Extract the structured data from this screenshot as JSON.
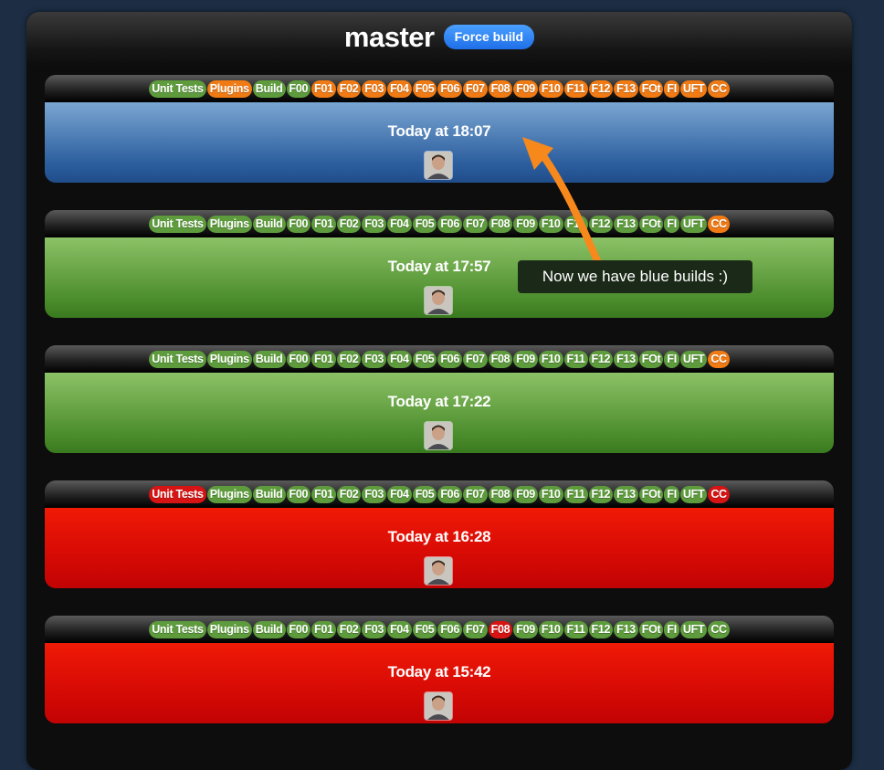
{
  "header": {
    "branch": "master",
    "force_build_label": "Force build"
  },
  "builds": [
    {
      "time": "Today at 18:07",
      "status": "blue",
      "stages": [
        {
          "label": "Unit Tests",
          "status": "green"
        },
        {
          "label": "Plugins",
          "status": "orange"
        },
        {
          "label": "Build",
          "status": "green"
        },
        {
          "label": "F00",
          "status": "green"
        },
        {
          "label": "F01",
          "status": "orange"
        },
        {
          "label": "F02",
          "status": "orange"
        },
        {
          "label": "F03",
          "status": "orange"
        },
        {
          "label": "F04",
          "status": "orange"
        },
        {
          "label": "F05",
          "status": "orange"
        },
        {
          "label": "F06",
          "status": "orange"
        },
        {
          "label": "F07",
          "status": "orange"
        },
        {
          "label": "F08",
          "status": "orange"
        },
        {
          "label": "F09",
          "status": "orange"
        },
        {
          "label": "F10",
          "status": "orange"
        },
        {
          "label": "F11",
          "status": "orange"
        },
        {
          "label": "F12",
          "status": "orange"
        },
        {
          "label": "F13",
          "status": "orange"
        },
        {
          "label": "FOt",
          "status": "orange"
        },
        {
          "label": "FI",
          "status": "orange"
        },
        {
          "label": "UFT",
          "status": "orange"
        },
        {
          "label": "CC",
          "status": "orange"
        }
      ]
    },
    {
      "time": "Today at 17:57",
      "status": "green",
      "stages": [
        {
          "label": "Unit Tests",
          "status": "green"
        },
        {
          "label": "Plugins",
          "status": "green"
        },
        {
          "label": "Build",
          "status": "green"
        },
        {
          "label": "F00",
          "status": "green"
        },
        {
          "label": "F01",
          "status": "green"
        },
        {
          "label": "F02",
          "status": "green"
        },
        {
          "label": "F03",
          "status": "green"
        },
        {
          "label": "F04",
          "status": "green"
        },
        {
          "label": "F05",
          "status": "green"
        },
        {
          "label": "F06",
          "status": "green"
        },
        {
          "label": "F07",
          "status": "green"
        },
        {
          "label": "F08",
          "status": "green"
        },
        {
          "label": "F09",
          "status": "green"
        },
        {
          "label": "F10",
          "status": "green"
        },
        {
          "label": "F11",
          "status": "green"
        },
        {
          "label": "F12",
          "status": "green"
        },
        {
          "label": "F13",
          "status": "green"
        },
        {
          "label": "FOt",
          "status": "green"
        },
        {
          "label": "FI",
          "status": "green"
        },
        {
          "label": "UFT",
          "status": "green"
        },
        {
          "label": "CC",
          "status": "orange"
        }
      ]
    },
    {
      "time": "Today at 17:22",
      "status": "green",
      "stages": [
        {
          "label": "Unit Tests",
          "status": "green"
        },
        {
          "label": "Plugins",
          "status": "green"
        },
        {
          "label": "Build",
          "status": "green"
        },
        {
          "label": "F00",
          "status": "green"
        },
        {
          "label": "F01",
          "status": "green"
        },
        {
          "label": "F02",
          "status": "green"
        },
        {
          "label": "F03",
          "status": "green"
        },
        {
          "label": "F04",
          "status": "green"
        },
        {
          "label": "F05",
          "status": "green"
        },
        {
          "label": "F06",
          "status": "green"
        },
        {
          "label": "F07",
          "status": "green"
        },
        {
          "label": "F08",
          "status": "green"
        },
        {
          "label": "F09",
          "status": "green"
        },
        {
          "label": "F10",
          "status": "green"
        },
        {
          "label": "F11",
          "status": "green"
        },
        {
          "label": "F12",
          "status": "green"
        },
        {
          "label": "F13",
          "status": "green"
        },
        {
          "label": "FOt",
          "status": "green"
        },
        {
          "label": "FI",
          "status": "green"
        },
        {
          "label": "UFT",
          "status": "green"
        },
        {
          "label": "CC",
          "status": "orange"
        }
      ]
    },
    {
      "time": "Today at 16:28",
      "status": "red",
      "stages": [
        {
          "label": "Unit Tests",
          "status": "red"
        },
        {
          "label": "Plugins",
          "status": "green"
        },
        {
          "label": "Build",
          "status": "green"
        },
        {
          "label": "F00",
          "status": "green"
        },
        {
          "label": "F01",
          "status": "green"
        },
        {
          "label": "F02",
          "status": "green"
        },
        {
          "label": "F03",
          "status": "green"
        },
        {
          "label": "F04",
          "status": "green"
        },
        {
          "label": "F05",
          "status": "green"
        },
        {
          "label": "F06",
          "status": "green"
        },
        {
          "label": "F07",
          "status": "green"
        },
        {
          "label": "F08",
          "status": "green"
        },
        {
          "label": "F09",
          "status": "green"
        },
        {
          "label": "F10",
          "status": "green"
        },
        {
          "label": "F11",
          "status": "green"
        },
        {
          "label": "F12",
          "status": "green"
        },
        {
          "label": "F13",
          "status": "green"
        },
        {
          "label": "FOt",
          "status": "green"
        },
        {
          "label": "FI",
          "status": "green"
        },
        {
          "label": "UFT",
          "status": "green"
        },
        {
          "label": "CC",
          "status": "red"
        }
      ]
    },
    {
      "time": "Today at 15:42",
      "status": "red",
      "stages": [
        {
          "label": "Unit Tests",
          "status": "green"
        },
        {
          "label": "Plugins",
          "status": "green"
        },
        {
          "label": "Build",
          "status": "green"
        },
        {
          "label": "F00",
          "status": "green"
        },
        {
          "label": "F01",
          "status": "green"
        },
        {
          "label": "F02",
          "status": "green"
        },
        {
          "label": "F03",
          "status": "green"
        },
        {
          "label": "F04",
          "status": "green"
        },
        {
          "label": "F05",
          "status": "green"
        },
        {
          "label": "F06",
          "status": "green"
        },
        {
          "label": "F07",
          "status": "green"
        },
        {
          "label": "F08",
          "status": "red"
        },
        {
          "label": "F09",
          "status": "green"
        },
        {
          "label": "F10",
          "status": "green"
        },
        {
          "label": "F11",
          "status": "green"
        },
        {
          "label": "F12",
          "status": "green"
        },
        {
          "label": "F13",
          "status": "green"
        },
        {
          "label": "FOt",
          "status": "green"
        },
        {
          "label": "FI",
          "status": "green"
        },
        {
          "label": "UFT",
          "status": "green"
        },
        {
          "label": "CC",
          "status": "green"
        }
      ]
    }
  ],
  "annotation": {
    "text": "Now we have blue builds :)",
    "arrow_color": "#f7891c"
  },
  "colors": {
    "green": "#5d9b3d",
    "orange": "#f07a14",
    "red": "#d71414",
    "blue_build": "#2d5f9f",
    "button": "#1f6fe8"
  }
}
